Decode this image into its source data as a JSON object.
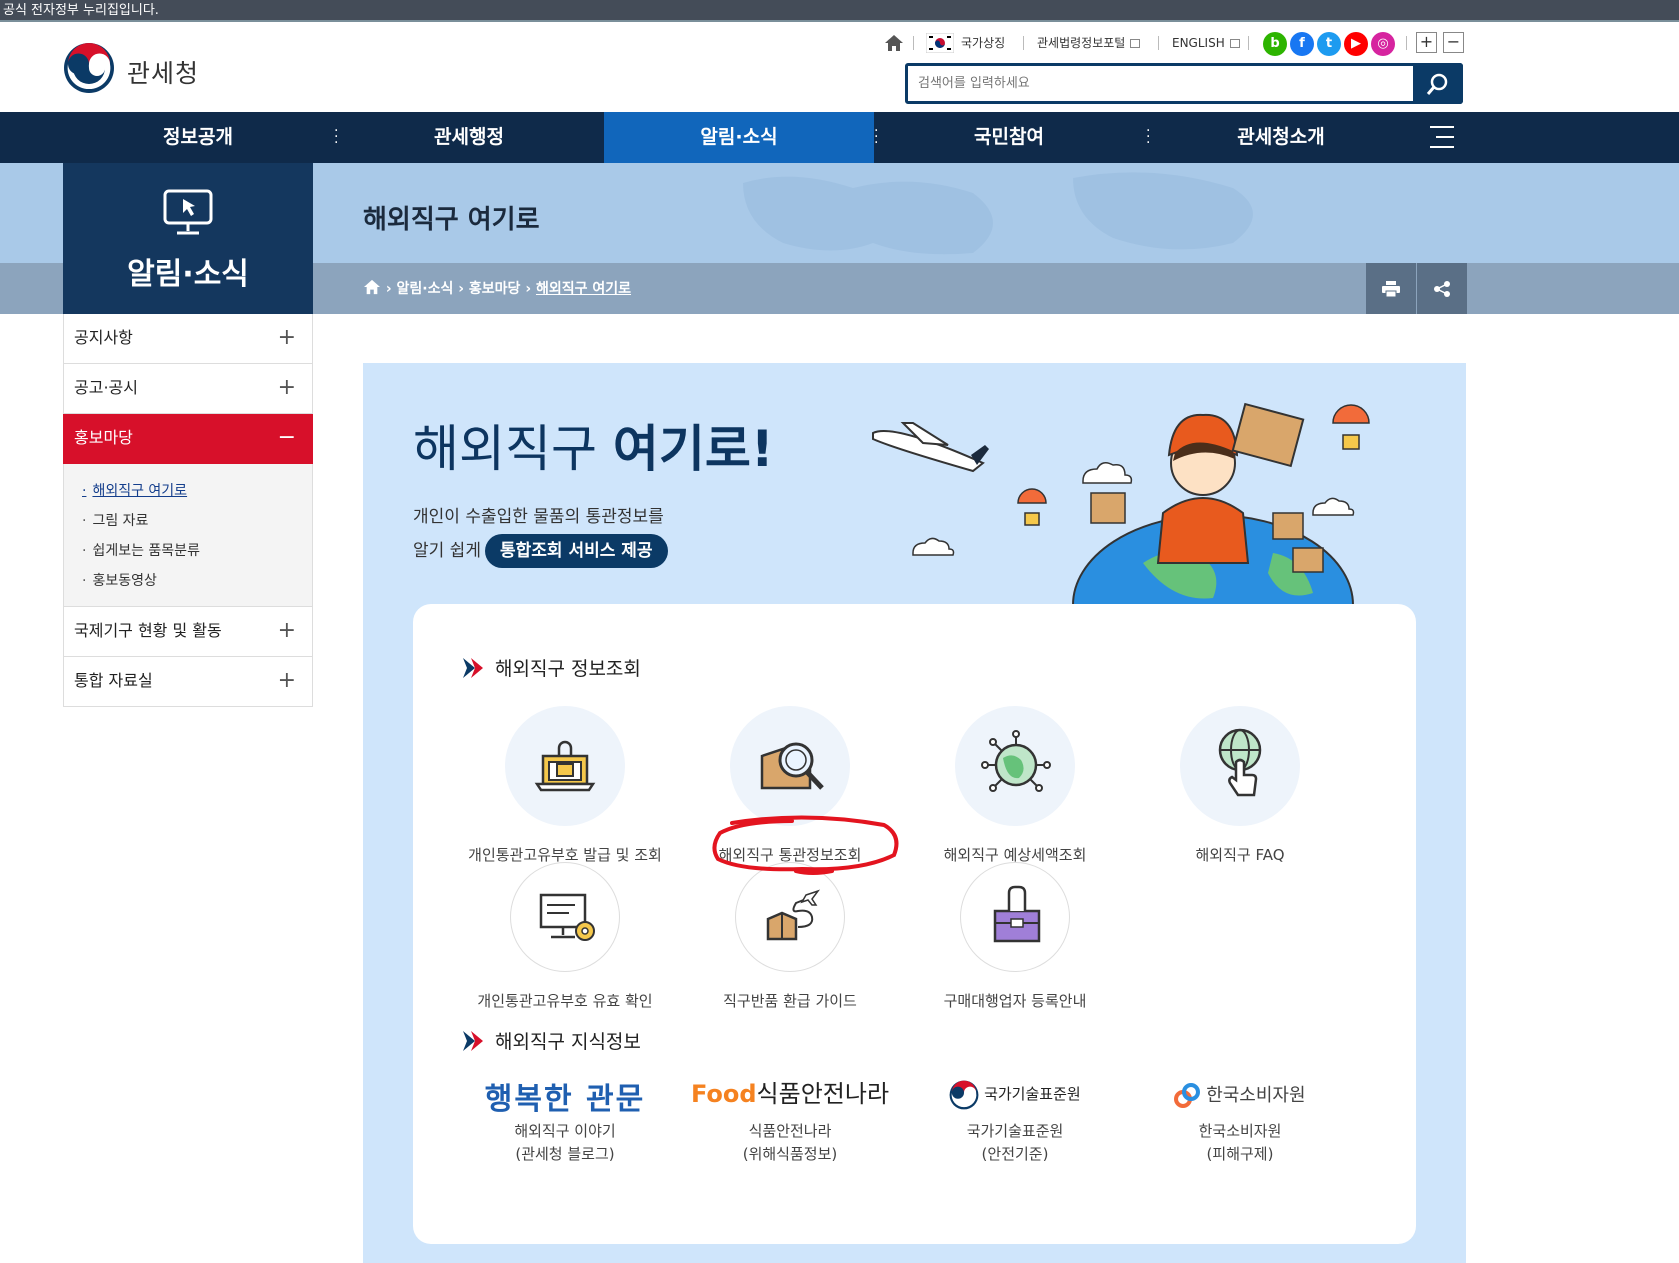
{
  "gov_banner": "공식 전자정부 누리집입니다.",
  "brand": {
    "name": "관세청"
  },
  "utility": {
    "national_symbol": "국가상징",
    "law_portal": "관세법령정보포털",
    "english": "ENGLISH",
    "sns": [
      {
        "name": "blog",
        "glyph": "b",
        "color": "#2db400"
      },
      {
        "name": "facebook",
        "glyph": "f",
        "color": "#1877f2"
      },
      {
        "name": "twitter",
        "glyph": "t",
        "color": "#1d9bf0"
      },
      {
        "name": "youtube",
        "glyph": "▶",
        "color": "#ff0000"
      },
      {
        "name": "instagram",
        "glyph": "◎",
        "color": "#d6249f"
      }
    ],
    "zoom_in": "+",
    "zoom_out": "−"
  },
  "search": {
    "placeholder": "검색어를 입력하세요"
  },
  "gnb": [
    {
      "label": "정보공개"
    },
    {
      "label": "관세행정"
    },
    {
      "label": "알림·소식",
      "active": true
    },
    {
      "label": "국민참여"
    },
    {
      "label": "관세청소개"
    }
  ],
  "side_title": "알림·소식",
  "page_title": "해외직구 여기로",
  "breadcrumb": {
    "items": [
      "알림·소식",
      "홍보마당"
    ],
    "current": "해외직구 여기로"
  },
  "lnb": {
    "items": [
      {
        "label": "공지사항",
        "toggle": "+"
      },
      {
        "label": "공고·공시",
        "toggle": "+"
      },
      {
        "label": "홍보마당",
        "toggle": "−"
      },
      {
        "label": "국제기구 현황 및 활동",
        "toggle": "+"
      },
      {
        "label": "통합 자료실",
        "toggle": "+"
      }
    ],
    "sub_items": [
      "해외직구 여기로",
      "그림 자료",
      "쉽게보는 품목분류",
      "홍보동영상"
    ]
  },
  "hero": {
    "title_light": "해외직구",
    "title_bold": "여기로!",
    "desc_line1": "개인이 수출입한 물품의 통관정보를",
    "desc_line2_prefix": "알기 쉽게",
    "desc_pill": "통합조회 서비스 제공"
  },
  "section_info": {
    "title": "해외직구 정보조회",
    "services": [
      {
        "label": "개인통관고유부호 발급 및 조회",
        "icon": "laptop-lock-icon"
      },
      {
        "label": "해외직구 통관정보조회",
        "icon": "box-magnifier-icon"
      },
      {
        "label": "해외직구 예상세액조회",
        "icon": "globe-network-icon"
      },
      {
        "label": "해외직구 FAQ",
        "icon": "globe-hand-icon"
      },
      {
        "label": "개인통관고유부호 유효 확인",
        "icon": "monitor-gear-icon"
      },
      {
        "label": "직구반품 환급 가이드",
        "icon": "box-airplane-icon"
      },
      {
        "label": "구매대행업자 등록안내",
        "icon": "toolbox-hand-icon"
      }
    ]
  },
  "section_knowledge": {
    "title": "해외직구 지식정보",
    "links": [
      {
        "logo": "행복한 관문",
        "line1": "해외직구 이야기",
        "line2": "(관세청 블로그)"
      },
      {
        "logo_prefix": "Food",
        "logo": "식품안전나라",
        "line1": "식품안전나라",
        "line2": "(위해식품정보)"
      },
      {
        "logo": "국가기술표준원",
        "line1": "국가기술표준원",
        "line2": "(안전기준)"
      },
      {
        "logo": "한국소비자원",
        "line1": "한국소비자원",
        "line2": "(피해구제)"
      }
    ]
  },
  "colors": {
    "navy": "#0f2a4a",
    "active_blue": "#1166bb",
    "accent_red": "#d7102a",
    "panel_bg": "#cfe5fb"
  }
}
